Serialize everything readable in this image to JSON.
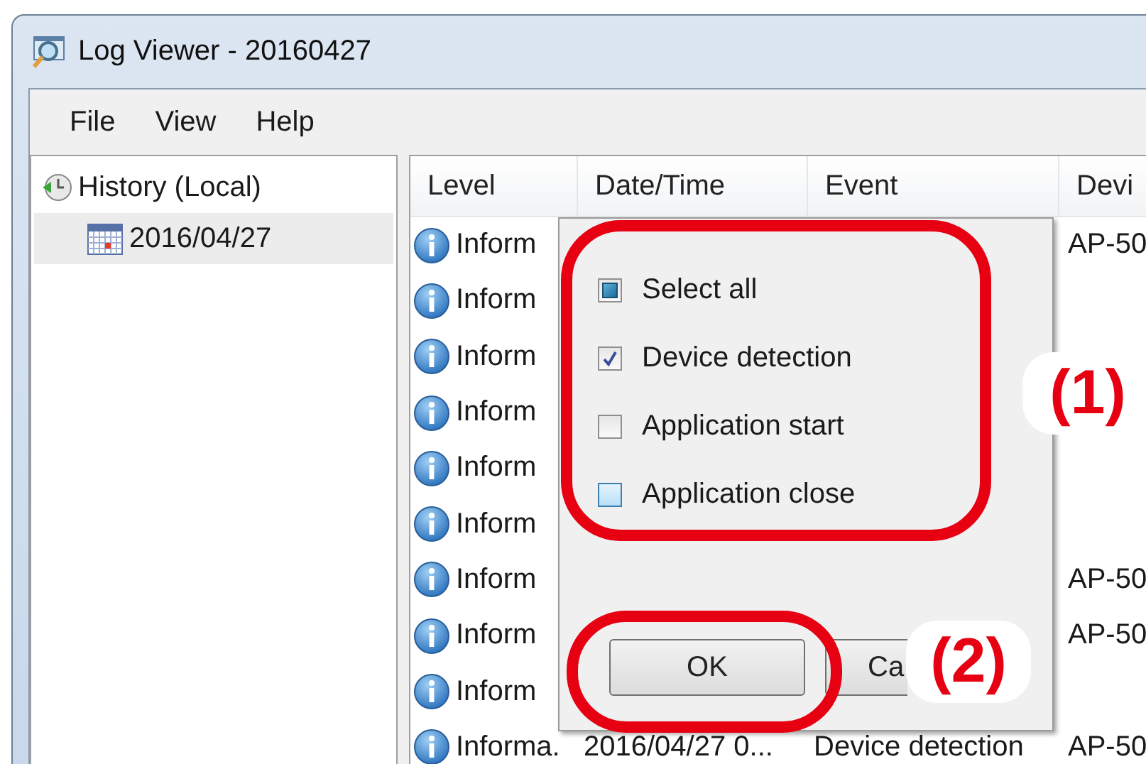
{
  "window": {
    "title": "Log Viewer - 20160427"
  },
  "menu": [
    "File",
    "View",
    "Help"
  ],
  "tree": [
    {
      "label": "History (Local)",
      "kind": "history",
      "selected": false,
      "children": [
        {
          "label": "2016/04/27",
          "kind": "date",
          "selected": true
        }
      ]
    }
  ],
  "table": {
    "columns": [
      "Level",
      "Date/Time",
      "Event",
      "Devi"
    ],
    "rows": [
      {
        "level": "Inform",
        "device": "AP-50"
      },
      {
        "level": "Inform"
      },
      {
        "level": "Inform"
      },
      {
        "level": "Inform"
      },
      {
        "level": "Inform"
      },
      {
        "level": "Inform"
      },
      {
        "level": "Inform",
        "device": "AP-50"
      },
      {
        "level": "Inform",
        "device": "AP-50"
      },
      {
        "level": "Inform"
      },
      {
        "level": "Informa.",
        "datetime": "2016/04/27 0...",
        "event": "Device detection",
        "device": "AP-50"
      }
    ]
  },
  "dialog": {
    "options": [
      {
        "label": "Select all",
        "checked": false,
        "partial": true,
        "hovered": false
      },
      {
        "label": "Device detection",
        "checked": true,
        "partial": false,
        "hovered": false
      },
      {
        "label": "Application start",
        "checked": false,
        "partial": false,
        "hovered": false
      },
      {
        "label": "Application close",
        "checked": false,
        "partial": false,
        "hovered": true
      }
    ],
    "buttons": [
      "OK",
      "Ca"
    ]
  },
  "annotations": [
    {
      "label": "(1)"
    },
    {
      "label": "(2)"
    }
  ]
}
